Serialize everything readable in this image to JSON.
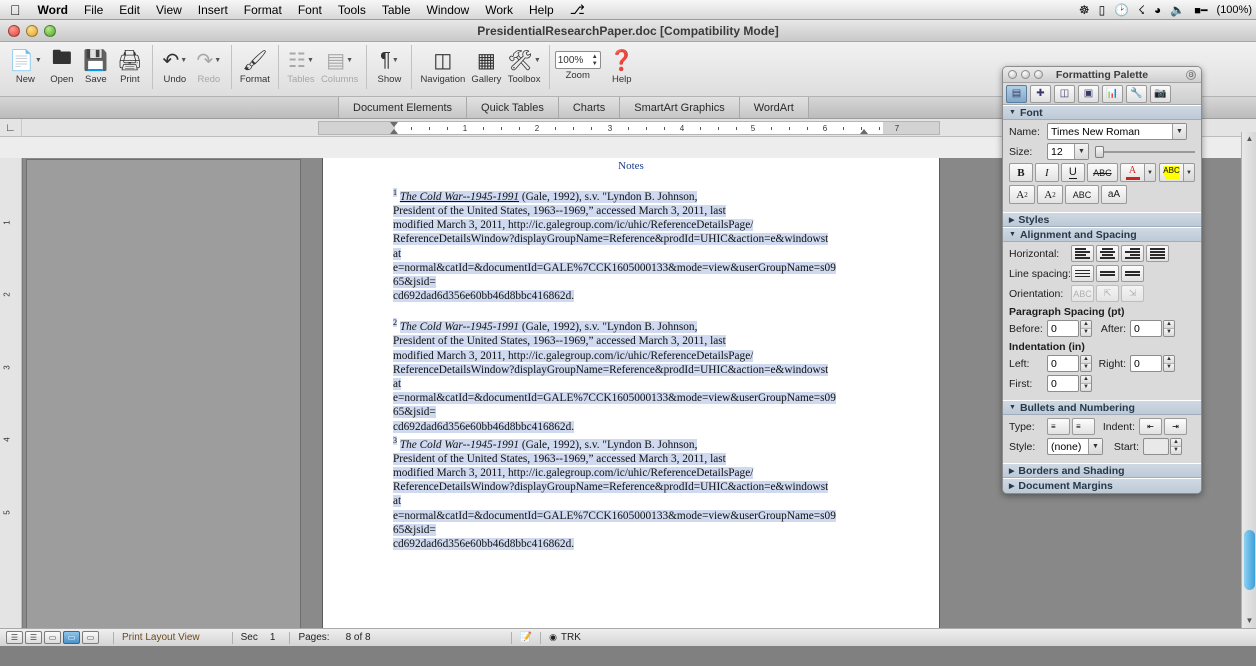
{
  "menubar": {
    "apple_icon": "apple-logo",
    "items": [
      {
        "label": "Word",
        "bold": true
      },
      {
        "label": "File"
      },
      {
        "label": "Edit"
      },
      {
        "label": "View"
      },
      {
        "label": "Insert"
      },
      {
        "label": "Format"
      },
      {
        "label": "Font"
      },
      {
        "label": "Tools"
      },
      {
        "label": "Table"
      },
      {
        "label": "Window"
      },
      {
        "label": "Work"
      },
      {
        "label": "Help"
      }
    ],
    "status_icons": [
      "skype-icon",
      "display-icon",
      "time-machine-icon",
      "bluetooth-icon",
      "wifi-icon",
      "volume-icon",
      "battery-icon"
    ],
    "battery_pct": "(100%)"
  },
  "window": {
    "title": "PresidentialResearchPaper.doc [Compatibility Mode]",
    "close_label": "close-window",
    "minimize_label": "minimize-window",
    "zoom_label": "zoom-window"
  },
  "toolbar": {
    "buttons": [
      {
        "label": "New",
        "icon": "new-document-icon",
        "arrow": true,
        "dim": false
      },
      {
        "label": "Open",
        "icon": "open-folder-icon",
        "arrow": false,
        "dim": false
      },
      {
        "label": "Save",
        "icon": "save-disk-icon",
        "arrow": false,
        "dim": false
      },
      {
        "label": "Print",
        "icon": "printer-icon",
        "arrow": false,
        "dim": false
      },
      {
        "label": "Undo",
        "icon": "undo-arrow-icon",
        "arrow": true,
        "dim": false
      },
      {
        "label": "Redo",
        "icon": "redo-arrow-icon",
        "arrow": true,
        "dim": true
      },
      {
        "label": "Format",
        "icon": "format-brush-icon",
        "arrow": false,
        "dim": false
      },
      {
        "label": "Tables",
        "icon": "table-grid-icon",
        "arrow": true,
        "dim": true
      },
      {
        "label": "Columns",
        "icon": "columns-icon",
        "arrow": true,
        "dim": true
      },
      {
        "label": "Show",
        "icon": "show-paragraph-icon",
        "arrow": true,
        "dim": false
      },
      {
        "label": "Navigation",
        "icon": "navigation-pane-icon",
        "arrow": false,
        "dim": false
      },
      {
        "label": "Gallery",
        "icon": "gallery-icon",
        "arrow": false,
        "dim": false
      },
      {
        "label": "Toolbox",
        "icon": "toolbox-icon",
        "arrow": true,
        "dim": false
      }
    ],
    "zoom": {
      "label": "Zoom",
      "value": "100%"
    },
    "help": {
      "label": "Help",
      "icon": "help-question-icon"
    }
  },
  "element_gallery": {
    "tabs": [
      {
        "label": "Document Elements"
      },
      {
        "label": "Quick Tables"
      },
      {
        "label": "Charts"
      },
      {
        "label": "SmartArt Graphics"
      },
      {
        "label": "WordArt"
      }
    ]
  },
  "ruler": {
    "tab_selector_icon": "tab-stop-icon",
    "numbers": [
      "1",
      "2",
      "3",
      "4",
      "5",
      "6",
      "7"
    ],
    "vertical_numbers": [
      "1",
      "2",
      "3",
      "4",
      "5"
    ]
  },
  "document": {
    "header_note": "Notes",
    "footnotes": [
      {
        "marker": "1",
        "lines": [
          {
            "t": "The Cold War--1945-1991",
            "style": "italic-underline"
          },
          {
            "t": " (Gale, 1992), s.v. \"Lyndon B. Johnson,",
            "style": "plain"
          }
        ],
        "body": [
          "President of the United States, 1963--1969,” accessed March 3, 2011, last",
          "modified March 3, 2011, http://ic.galegroup.com/ic/uhic/ReferenceDetailsPage/",
          "ReferenceDetailsWindow?displayGroupName=Reference&prodId=UHIC&action=e&windowst",
          "at",
          "e=normal&catId=&documentId=GALE%7CCK1605000133&mode=view&userGroupName=s09",
          "65&jsid=",
          "cd692dad6d356e60bb46d8bbc416862d."
        ]
      },
      {
        "marker": "2",
        "lines": [
          {
            "t": "The Cold War--1945-1991",
            "style": "italic"
          },
          {
            "t": " (Gale, 1992), s.v. \"Lyndon B. Johnson,",
            "style": "plain"
          }
        ],
        "body": [
          "President of the United States, 1963--1969,” accessed March 3, 2011, last",
          "modified March 3, 2011, http://ic.galegroup.com/ic/uhic/ReferenceDetailsPage/",
          "ReferenceDetailsWindow?displayGroupName=Reference&prodId=UHIC&action=e&windowst",
          "at",
          "e=normal&catId=&documentId=GALE%7CCK1605000133&mode=view&userGroupName=s09",
          "65&jsid=",
          "cd692dad6d356e60bb46d8bbc416862d."
        ]
      },
      {
        "marker": "3",
        "lines": [
          {
            "t": "The Cold War--1945-1991",
            "style": "italic"
          },
          {
            "t": " (Gale, 1992), s.v. \"Lyndon B. Johnson,",
            "style": "plain"
          }
        ],
        "body": [
          "President of the United States, 1963--1969,” accessed March 3, 2011, last",
          "modified March 3, 2011, http://ic.galegroup.com/ic/uhic/ReferenceDetailsPage/",
          "ReferenceDetailsWindow?displayGroupName=Reference&prodId=UHIC&action=e&windowst",
          "at",
          "e=normal&catId=&documentId=GALE%7CCK1605000133&mode=view&userGroupName=s09",
          "65&jsid=",
          "cd692dad6d356e60bb46d8bbc416862d."
        ]
      }
    ]
  },
  "palette": {
    "title": "Formatting Palette",
    "toolbar_icons": [
      "text-format-icon",
      "add-objects-icon",
      "layout-icon",
      "document-theme-icon",
      "chart-icon",
      "tools-icon",
      "media-icon"
    ],
    "font": {
      "header": "Font",
      "name_label": "Name:",
      "name_value": "Times New Roman",
      "size_label": "Size:",
      "size_value": "12",
      "bold": "B",
      "italic": "I",
      "underline": "U",
      "strikethrough": "ABC",
      "font_color": "A",
      "highlight": "ABC",
      "superscript": "A2",
      "subscript": "A2",
      "smallcaps": "ABC",
      "change_case": "aA",
      "font_color_hex": "#cc2222",
      "highlight_hex": "#ffff00"
    },
    "styles": {
      "header": "Styles"
    },
    "alignment": {
      "header": "Alignment and Spacing",
      "horizontal_label": "Horizontal:",
      "line_spacing_label": "Line spacing:",
      "orientation_label": "Orientation:",
      "para_spacing_label": "Paragraph Spacing (pt)",
      "before_label": "Before:",
      "before_value": "0",
      "after_label": "After:",
      "after_value": "0",
      "indentation_label": "Indentation (in)",
      "left_label": "Left:",
      "left_value": "0",
      "right_label": "Right:",
      "right_value": "0",
      "first_label": "First:",
      "first_value": "0"
    },
    "bullets": {
      "header": "Bullets and Numbering",
      "type_label": "Type:",
      "indent_label": "Indent:",
      "style_label": "Style:",
      "style_value": "(none)",
      "start_label": "Start:",
      "start_value": ""
    },
    "borders": {
      "header": "Borders and Shading"
    },
    "margins": {
      "header": "Document Margins"
    }
  },
  "statusbar": {
    "view_icons": [
      "draft-view-icon",
      "outline-view-icon",
      "publishing-view-icon",
      "print-layout-view-icon",
      "notebook-view-icon"
    ],
    "view_label": "Print Layout View",
    "section_label": "Sec",
    "section_value": "1",
    "pages_label": "Pages:",
    "pages_value": "8 of 8",
    "spelling_icon": "spelling-check-icon",
    "track_changes_icon": "track-changes-icon",
    "track_label": "TRK"
  }
}
